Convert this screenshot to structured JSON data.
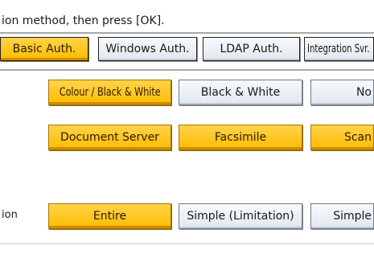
{
  "instruction": "ion method, then press [OK].",
  "auth_tabs": {
    "basic": "Basic Auth.",
    "windows": "Windows Auth.",
    "ldap": "LDAP Auth.",
    "integration": "Integration Svr."
  },
  "printer_job": {
    "colour_bw": "Colour / Black & White",
    "black_white": "Black & White",
    "no": "No"
  },
  "functions": {
    "document_server": "Document Server",
    "facsimile": "Facsimile",
    "scanner": "Scan"
  },
  "range_row": {
    "label": "ion",
    "entire": "Entire",
    "simple_limitation": "Simple (Limitation)",
    "simple": "Simple"
  }
}
